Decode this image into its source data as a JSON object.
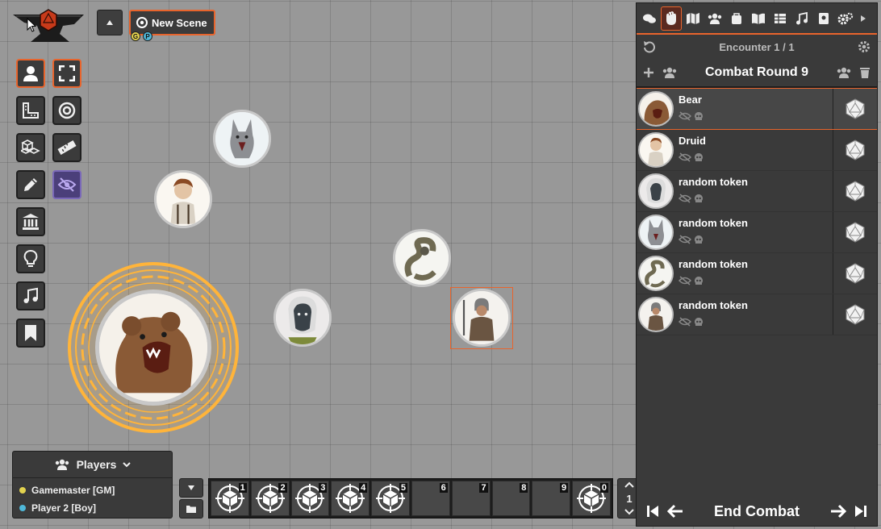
{
  "toolbar": {
    "scene_label": "New Scene",
    "scene_badges": [
      "G",
      "P"
    ]
  },
  "tools": [
    {
      "name": "select-tool",
      "icon": "user-icon",
      "active": true
    },
    {
      "name": "fullscreen-tool",
      "icon": "expand-icon",
      "active": true
    },
    {
      "name": "measure-tool",
      "icon": "ruler-square-icon",
      "active": false
    },
    {
      "name": "target-tool",
      "icon": "target-icon",
      "active": false
    },
    {
      "name": "blocks-tool",
      "icon": "cubes-icon",
      "active": false
    },
    {
      "name": "ruler-tool",
      "icon": "ruler-icon",
      "active": false
    },
    {
      "name": "draw-tool",
      "icon": "pencil-icon",
      "active": false
    },
    {
      "name": "visibility-tool",
      "icon": "eye-slash-icon",
      "active": false
    },
    {
      "name": "walls-tool",
      "icon": "museum-icon",
      "active": false
    },
    {
      "name": "lighting-tool",
      "icon": "lightbulb-icon",
      "active": false
    },
    {
      "name": "sounds-tool",
      "icon": "music-icon",
      "active": false
    },
    {
      "name": "notes-tool",
      "icon": "bookmark-icon",
      "active": false
    }
  ],
  "players": {
    "title": "Players",
    "list": [
      {
        "name": "Gamemaster [GM]",
        "color": "#e3d34f"
      },
      {
        "name": "Player 2 [Boy]",
        "color": "#4fb8d9"
      }
    ]
  },
  "hotbar": {
    "slots": [
      "1",
      "2",
      "3",
      "4",
      "5",
      "6",
      "7",
      "8",
      "9",
      "0"
    ],
    "page": "1"
  },
  "sidebar": {
    "tabs": [
      "chat-icon",
      "combat-icon",
      "map-icon",
      "actors-icon",
      "items-icon",
      "journal-icon",
      "tables-icon",
      "playlist-icon",
      "compendium-icon",
      "settings-icon",
      "collapse-icon"
    ],
    "encounter_label": "Encounter 1 / 1",
    "round_label": "Combat Round 9",
    "combatants": [
      {
        "name": "Bear",
        "portrait": "bear",
        "active": true
      },
      {
        "name": "Druid",
        "portrait": "druid",
        "active": false
      },
      {
        "name": "random token",
        "portrait": "drow",
        "active": false
      },
      {
        "name": "random token",
        "portrait": "wolf",
        "active": false
      },
      {
        "name": "random token",
        "portrait": "serpent",
        "active": false
      },
      {
        "name": "random token",
        "portrait": "warrior",
        "active": false
      }
    ],
    "end_combat_label": "End Combat"
  },
  "colors": {
    "accent": "#e8642c",
    "aura": "#ffb43a",
    "panel": "#3a3a3a"
  }
}
